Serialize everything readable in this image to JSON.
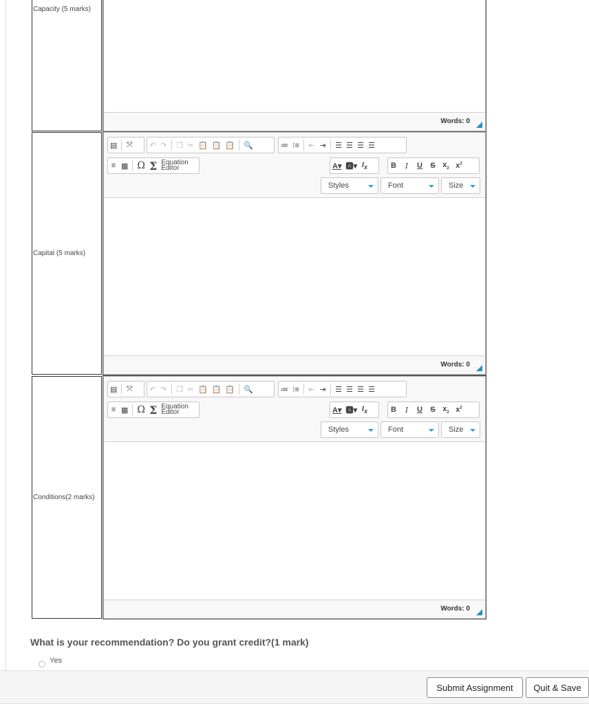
{
  "rows": [
    {
      "label": "Capacity (5 marks)",
      "words": "Words: 0"
    },
    {
      "label": "Capital (5 marks)",
      "words": "Words: 0"
    },
    {
      "label": "Conditions(2 marks)",
      "words": "Words: 0"
    }
  ],
  "toolbar": {
    "equation_top": "Equation",
    "equation_bottom": "Editor",
    "styles": "Styles",
    "font": "Font",
    "size": "Size"
  },
  "question": {
    "text": "What is your recommendation? Do you grant credit?(1 mark)",
    "options": [
      "Yes"
    ]
  },
  "footer": {
    "submit": "Submit Assignment",
    "quit": "Quit & Save"
  },
  "colors": {
    "accent": "#2a9fd6"
  }
}
